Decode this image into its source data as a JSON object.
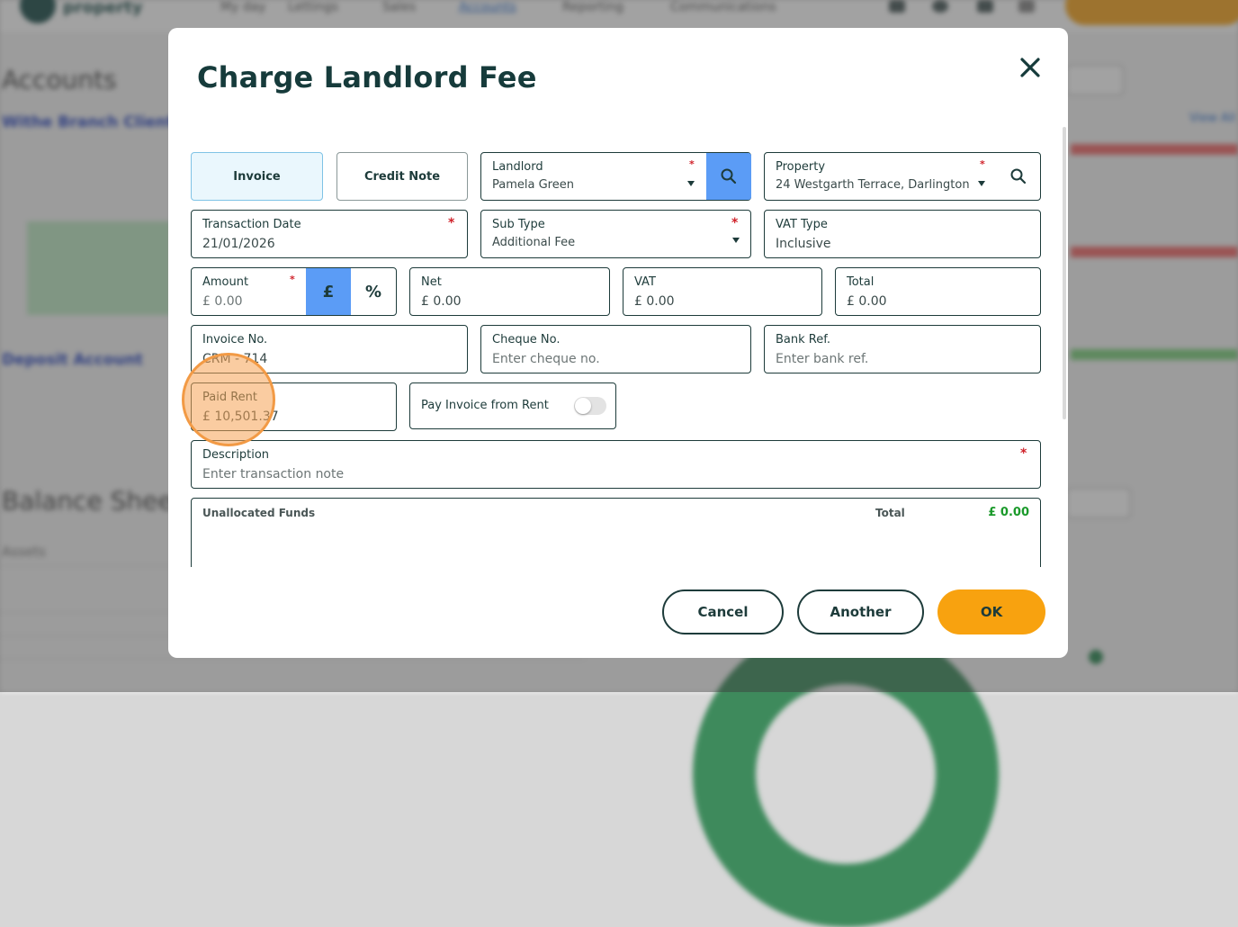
{
  "background": {
    "logo_text": "property",
    "nav": [
      "My day",
      "Lettings",
      "Sales",
      "Accounts",
      "Reporting",
      "Communications"
    ],
    "active_nav": "Accounts",
    "accounts_title": "Accounts",
    "account_one": "Withe Branch Client",
    "account_two": "Deposit Account",
    "balance_title": "Balance Sheet",
    "assets_label": "Assets",
    "view_all": "View All"
  },
  "modal": {
    "title": "Charge Landlord Fee",
    "close_icon": "close-icon"
  },
  "doc_type": {
    "invoice_label": "Invoice",
    "credit_note_label": "Credit Note",
    "selected": "Invoice"
  },
  "landlord": {
    "label": "Landlord",
    "value": "Pamela Green"
  },
  "property": {
    "label": "Property",
    "value": "24 Westgarth Terrace, Darlington"
  },
  "transaction_date": {
    "label": "Transaction Date",
    "value": "21/01/2026"
  },
  "sub_type": {
    "label": "Sub Type",
    "value": "Additional Fee"
  },
  "vat_type": {
    "label": "VAT Type",
    "value": "Inclusive"
  },
  "amount": {
    "label": "Amount",
    "placeholder": "£ 0.00",
    "unit_pound": "£",
    "unit_percent": "%",
    "selected_unit": "£"
  },
  "net": {
    "label": "Net",
    "value": "£ 0.00"
  },
  "vat": {
    "label": "VAT",
    "value": "£ 0.00"
  },
  "total": {
    "label": "Total",
    "value": "£ 0.00"
  },
  "invoice_no": {
    "label": "Invoice No.",
    "value": "CRM - 714"
  },
  "cheque_no": {
    "label": "Cheque No.",
    "placeholder": "Enter cheque no."
  },
  "bank_ref": {
    "label": "Bank Ref.",
    "placeholder": "Enter bank ref."
  },
  "paid_rent": {
    "label": "Paid Rent",
    "value": "£ 10,501.37"
  },
  "pay_from_rent": {
    "label": "Pay Invoice from Rent",
    "enabled": false
  },
  "description": {
    "label": "Description",
    "placeholder": "Enter transaction note"
  },
  "unallocated": {
    "label": "Unallocated Funds",
    "total_label": "Total",
    "total_value": "£ 0.00"
  },
  "footer": {
    "cancel": "Cancel",
    "another": "Another",
    "ok": "OK"
  },
  "colors": {
    "accent_blue": "#5b9cf6",
    "primary_orange": "#f8a20f",
    "required_red": "#d0222a",
    "success_green": "#1a9a2a",
    "dark_teal": "#1d3b3a"
  }
}
